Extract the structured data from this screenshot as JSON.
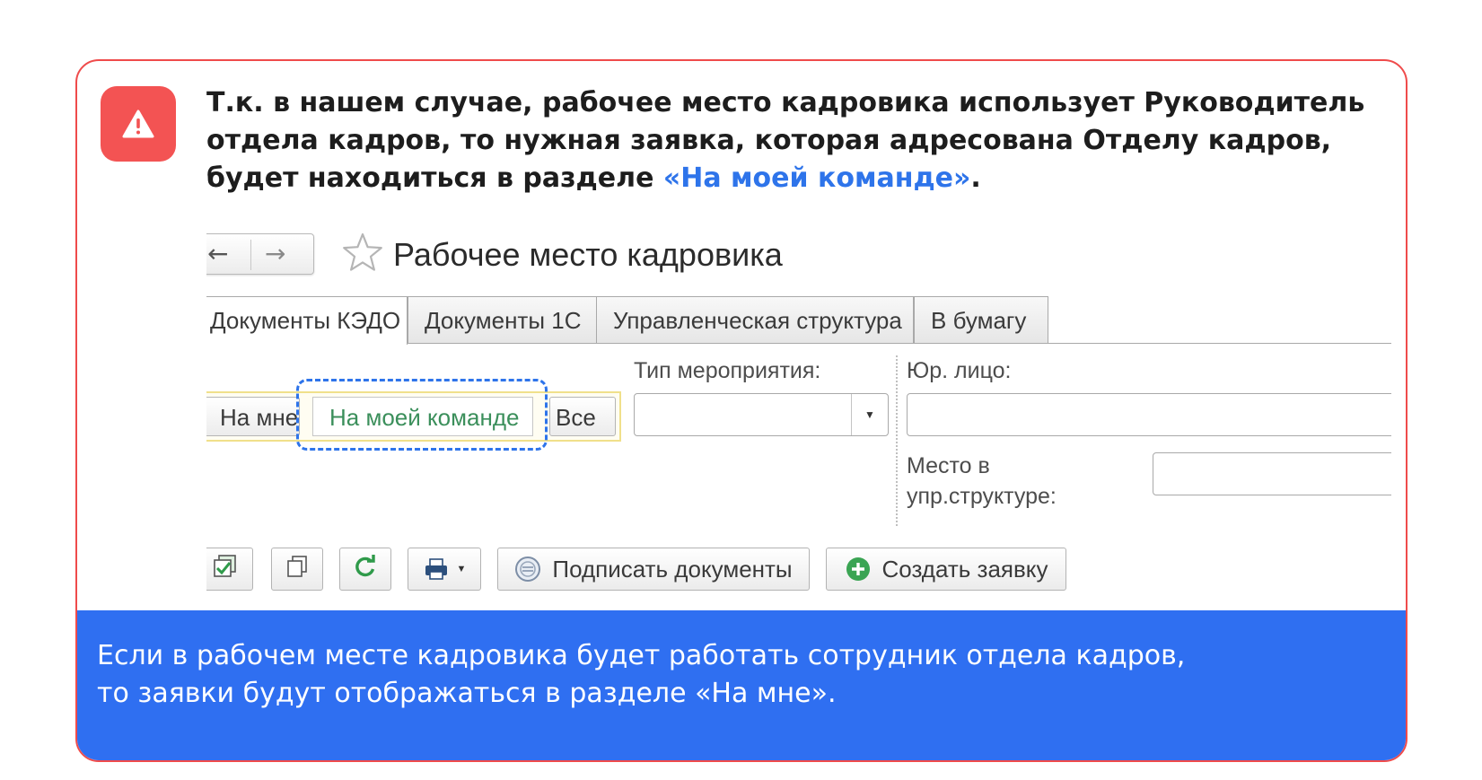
{
  "notice": {
    "line1": "Т.к. в нашем случае, рабочее место кадровика использует Руководитель",
    "line2": "отдела кадров, то нужная заявка, которая адресована Отделу кадров,",
    "line3_prefix": "будет находиться в разделе ",
    "line3_link": "«На моей команде»",
    "line3_suffix": "."
  },
  "workspace": {
    "title": "Рабочее место кадровика",
    "tabs": [
      {
        "label": "Документы КЭДО"
      },
      {
        "label": "Документы 1С"
      },
      {
        "label": "Управленческая структура"
      },
      {
        "label": "В бумагу"
      }
    ],
    "filter": {
      "options": [
        {
          "label": "На мне"
        },
        {
          "label": "На моей команде"
        },
        {
          "label": "Все"
        }
      ],
      "selected": "На моей команде"
    },
    "fields": {
      "event_type_label": "Тип мероприятия:",
      "legal_entity_label": "Юр. лицо:",
      "position_label_line1": "Место в",
      "position_label_line2": "упр.структуре:"
    },
    "toolbar": {
      "sign_label": "Подписать документы",
      "create_label": "Создать заявку"
    }
  },
  "footer": {
    "line1": "Если в рабочем месте кадровика будет работать сотрудник отдела кадров,",
    "line2": "то заявки будут отображаться в разделе «На мне»."
  },
  "colors": {
    "alert_red": "#f35353",
    "link_blue": "#2e74ea",
    "footer_blue": "#2f6ff1",
    "selected_green": "#3b8f5b"
  }
}
